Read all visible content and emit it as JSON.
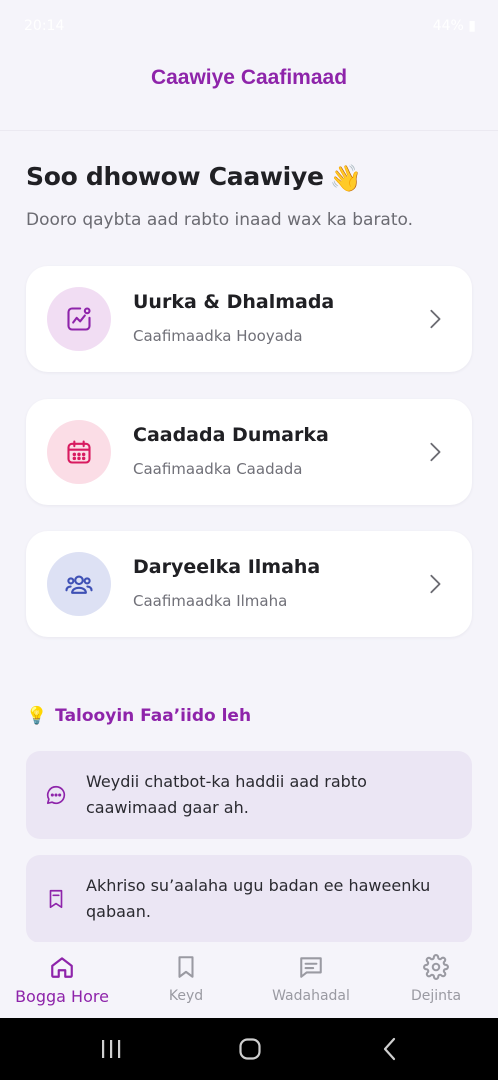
{
  "status": {
    "time": "20:14",
    "right": "44% ▮"
  },
  "header": {
    "title": "Caawiye Caafimaad"
  },
  "welcome": {
    "title": "Soo dhowow Caawiye",
    "subtitle": "Dooro qaybta aad rabto inaad wax ka barato."
  },
  "cards": [
    {
      "title": "Uurka & Dhalmada",
      "subtitle": "Caafimaadka Hooyada",
      "icon": "pregnancy-chart-icon",
      "color": "#8e24aa",
      "bg": "#f1ddf3"
    },
    {
      "title": "Caadada Dumarka",
      "subtitle": "Caafimaadka Caadada",
      "icon": "calendar-icon",
      "color": "#d81b60",
      "bg": "#fbdde6"
    },
    {
      "title": "Daryeelka Ilmaha",
      "subtitle": "Caafimaadka Ilmaha",
      "icon": "group-icon",
      "color": "#3f51b5",
      "bg": "#dde1f4"
    }
  ],
  "tips": {
    "heading": "Talooyin Faa’iido leh",
    "items": [
      {
        "text": "Weydii chatbot-ka haddii aad rabto caawimaad gaar ah.",
        "icon": "chat-bubble-icon"
      },
      {
        "text": "Akhriso su’aalaha ugu badan ee haweenku qabaan.",
        "icon": "bookmark-icon"
      }
    ]
  },
  "nav": {
    "items": [
      {
        "label": "Bogga Hore",
        "icon": "home-icon",
        "active": true
      },
      {
        "label": "Keyd",
        "icon": "bookmark-icon",
        "active": false
      },
      {
        "label": "Wadahadal",
        "icon": "chat-icon",
        "active": false
      },
      {
        "label": "Dejinta",
        "icon": "settings-icon",
        "active": false
      }
    ]
  },
  "colors": {
    "accent": "#8e24aa",
    "background": "#f5f4fa",
    "tip_bg": "#ebe6f4"
  }
}
